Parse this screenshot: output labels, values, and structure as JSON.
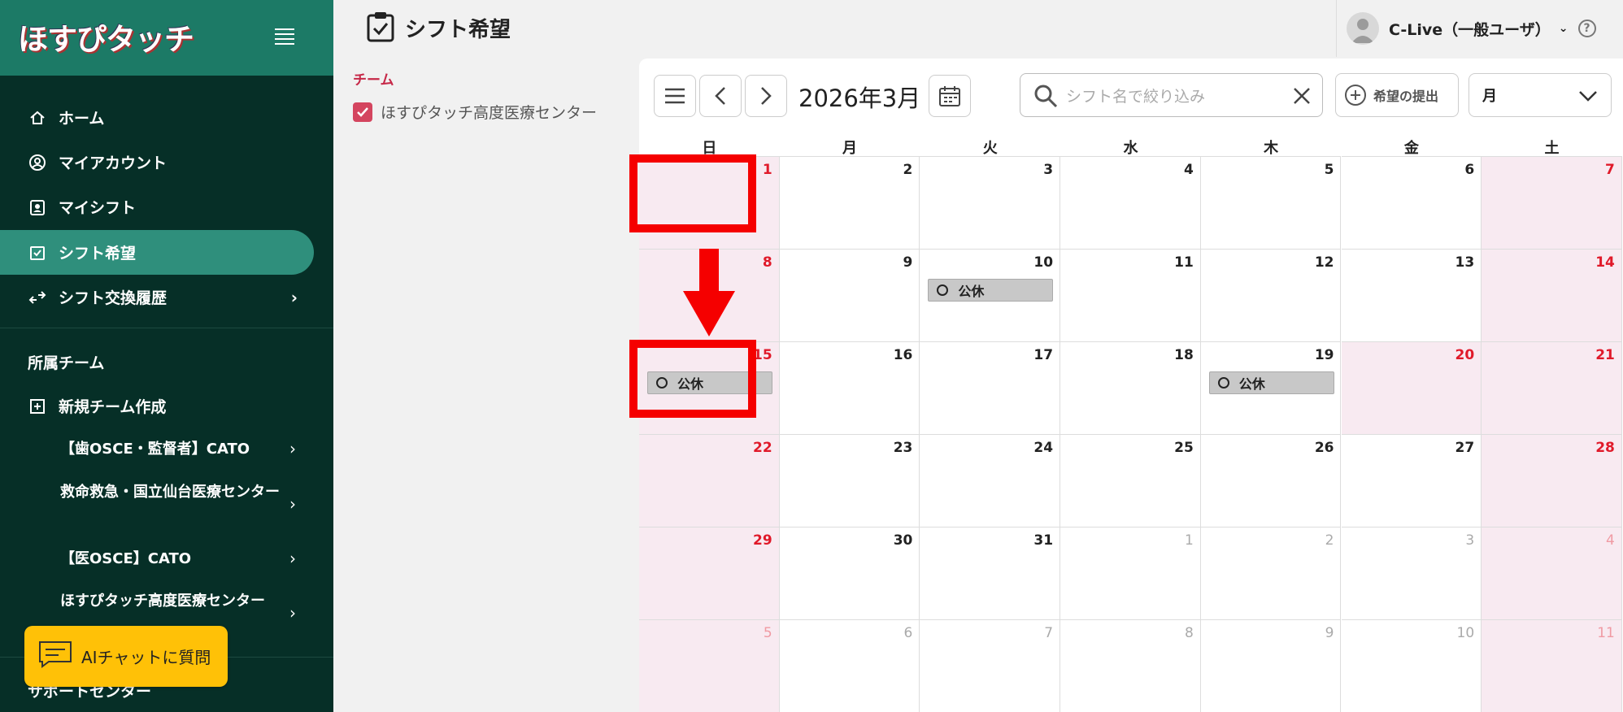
{
  "app": {
    "logo_text": "ほすぴタッチ"
  },
  "sidebar": {
    "nav": [
      {
        "label": "ホーム",
        "icon": "home-icon"
      },
      {
        "label": "マイアカウント",
        "icon": "account-icon"
      },
      {
        "label": "マイシフト",
        "icon": "badge-icon"
      },
      {
        "label": "シフト希望",
        "icon": "calendar-check-icon",
        "active": true
      },
      {
        "label": "シフト交換履歴",
        "icon": "swap-icon"
      }
    ],
    "section_label": "所属チーム",
    "new_team_label": "新規チーム作成",
    "teams": [
      "【歯OSCE・監督者】CATO",
      "救命救急・国立仙台医療センター",
      "【医OSCE】CATO",
      "ほすぴタッチ高度医療センター"
    ],
    "support_label": "サポートセンター",
    "ai_chat_label": "AIチャットに質問"
  },
  "header": {
    "page_title": "シフト希望",
    "user_name": "C-Live（一般ユーザ）"
  },
  "filter": {
    "team_heading": "チーム",
    "team_option": "ほすぴタッチ高度医療センター"
  },
  "calendar": {
    "month_label": "2026年3月",
    "search_placeholder": "シフト名で絞り込み",
    "submit_label": "希望の提出",
    "view_select": "月",
    "weekdays": [
      "日",
      "月",
      "火",
      "水",
      "木",
      "金",
      "土"
    ],
    "weeks": [
      [
        {
          "d": "1",
          "k": "sun"
        },
        {
          "d": "2"
        },
        {
          "d": "3"
        },
        {
          "d": "4"
        },
        {
          "d": "5"
        },
        {
          "d": "6"
        },
        {
          "d": "7",
          "k": "sat"
        }
      ],
      [
        {
          "d": "8",
          "k": "sun"
        },
        {
          "d": "9"
        },
        {
          "d": "10",
          "e": "公休"
        },
        {
          "d": "11"
        },
        {
          "d": "12"
        },
        {
          "d": "13"
        },
        {
          "d": "14",
          "k": "sat"
        }
      ],
      [
        {
          "d": "15",
          "k": "sun",
          "e": "公休"
        },
        {
          "d": "16"
        },
        {
          "d": "17"
        },
        {
          "d": "18"
        },
        {
          "d": "19",
          "e": "公休"
        },
        {
          "d": "20",
          "k": "hol"
        },
        {
          "d": "21",
          "k": "sat"
        }
      ],
      [
        {
          "d": "22",
          "k": "sun"
        },
        {
          "d": "23"
        },
        {
          "d": "24"
        },
        {
          "d": "25"
        },
        {
          "d": "26"
        },
        {
          "d": "27"
        },
        {
          "d": "28",
          "k": "sat"
        }
      ],
      [
        {
          "d": "29",
          "k": "sun"
        },
        {
          "d": "30"
        },
        {
          "d": "31"
        },
        {
          "d": "1",
          "k": "out"
        },
        {
          "d": "2",
          "k": "out"
        },
        {
          "d": "3",
          "k": "out"
        },
        {
          "d": "4",
          "k": "outsat"
        }
      ],
      [
        {
          "d": "5",
          "k": "outsun"
        },
        {
          "d": "6",
          "k": "out"
        },
        {
          "d": "7",
          "k": "out"
        },
        {
          "d": "8",
          "k": "out"
        },
        {
          "d": "9",
          "k": "out"
        },
        {
          "d": "10",
          "k": "out"
        },
        {
          "d": "11",
          "k": "outsat"
        }
      ]
    ]
  },
  "colors": {
    "sidebar": "#062f27",
    "accent": "#2f8f7c",
    "highlight": "#f50000",
    "weekend": "#f8eaf1"
  }
}
